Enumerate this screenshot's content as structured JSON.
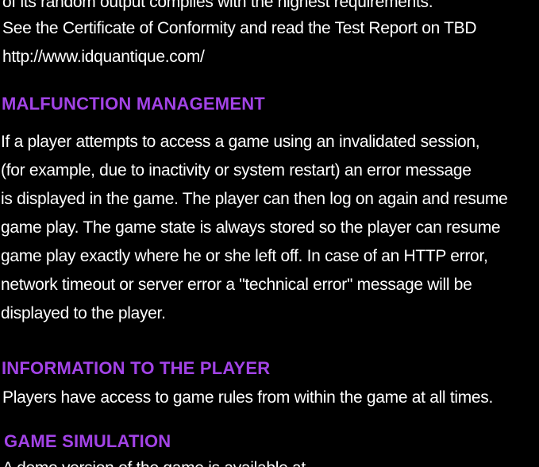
{
  "colors": {
    "background": "#000000",
    "body_text": "#ffffff",
    "heading": "#a243e6"
  },
  "intro": {
    "line_partial": "of its random output complies with the highest requirements.",
    "certificate_line": "See the Certificate of Conformity and read the Test Report on TBD",
    "url": "http://www.idquantique.com/"
  },
  "malfunction": {
    "heading": "MALFUNCTION  MANAGEMENT",
    "lines": [
      "If a player attempts to access a game using an invalidated session,",
      " (for example, due to inactivity or system restart) an error message",
      "is displayed in the game. The player can then log on again and resume",
      "game play. The game state is always stored so the player can resume",
      "game play exactly where he or she left off. In case of an HTTP error,",
      "network timeout or server error a \"technical error\" message will be",
      "displayed to the player."
    ]
  },
  "information": {
    "heading": "INFORMATION  TO  THE  PLAYER",
    "line": "Players have access to game rules from within the game at all times."
  },
  "simulation": {
    "heading": "GAME  SIMULATION",
    "line_partial": "A demo version of the game is available at"
  }
}
